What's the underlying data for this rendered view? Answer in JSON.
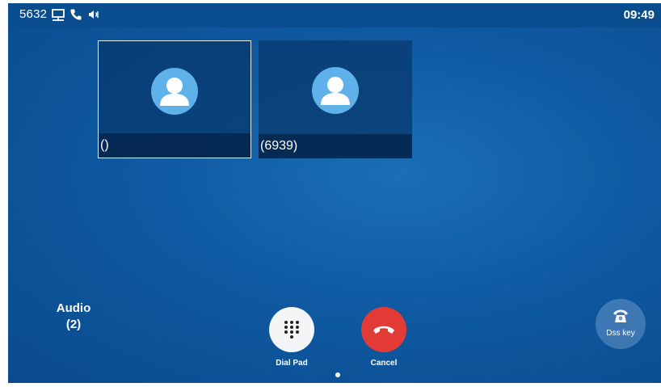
{
  "status_bar": {
    "extension": "5632",
    "time": "09:49",
    "icons": [
      "network-icon",
      "phone-icon",
      "speaker-icon"
    ]
  },
  "participants": [
    {
      "name": "()",
      "selected": true,
      "icon": "avatar-icon"
    },
    {
      "name": "(6939)",
      "selected": false,
      "icon": "avatar-icon"
    }
  ],
  "audio": {
    "label": "Audio",
    "count": "(2)"
  },
  "actions": {
    "dial_pad_label": "Dial Pad",
    "cancel_label": "Cancel"
  },
  "dss": {
    "label": "Dss key",
    "icon": "telephone-icon"
  },
  "colors": {
    "background": "#0f5aa2",
    "status_bar": "#0a4d8f",
    "cancel": "#e23b35",
    "avatar": "#5fb1ea"
  }
}
